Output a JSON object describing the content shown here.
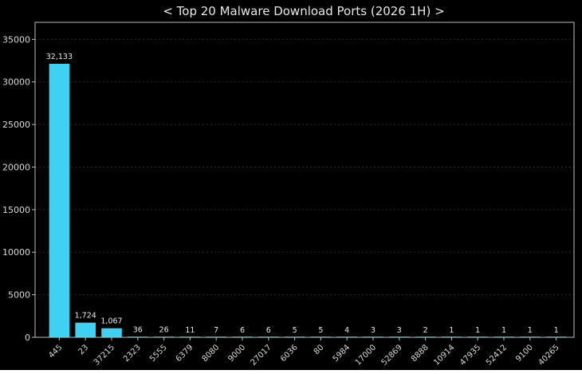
{
  "chart_data": {
    "type": "bar",
    "title": "< Top 20 Malware Download Ports (2026 1H) >",
    "xlabel": "",
    "ylabel": "",
    "categories": [
      "445",
      "23",
      "37215",
      "2323",
      "5555",
      "6379",
      "8080",
      "9000",
      "27017",
      "6036",
      "80",
      "5984",
      "17000",
      "52869",
      "8888",
      "10914",
      "47935",
      "52412",
      "9100",
      "40265"
    ],
    "values": [
      32133,
      1724,
      1067,
      36,
      26,
      11,
      7,
      6,
      6,
      5,
      5,
      4,
      3,
      3,
      2,
      1,
      1,
      1,
      1,
      1
    ],
    "value_labels": [
      "32,133",
      "1,724",
      "1,067",
      "36",
      "26",
      "11",
      "7",
      "6",
      "6",
      "5",
      "5",
      "4",
      "3",
      "3",
      "2",
      "1",
      "1",
      "1",
      "1",
      "1"
    ],
    "ylim": [
      0,
      37000
    ],
    "yticks": [
      0,
      5000,
      10000,
      15000,
      20000,
      25000,
      30000,
      35000
    ],
    "ytick_labels": [
      "0",
      "5000",
      "10000",
      "15000",
      "20000",
      "25000",
      "30000",
      "35000"
    ],
    "grid": true,
    "bar_color": "#3fd1f2",
    "background_color": "#000000",
    "text_color": "#e0e0e0"
  }
}
